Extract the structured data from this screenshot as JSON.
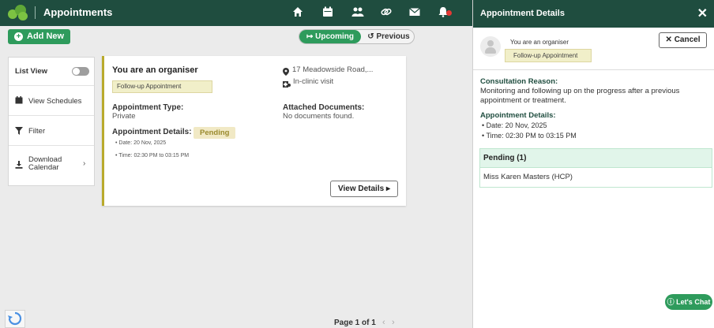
{
  "app": {
    "title": "Appointments"
  },
  "nav": {
    "icons": [
      "home-icon",
      "calendar-icon",
      "people-icon",
      "link-icon",
      "mail-icon",
      "bell-icon"
    ]
  },
  "toolbar": {
    "add_label": "Add New",
    "upcoming_label": "Upcoming",
    "previous_label": "Previous"
  },
  "sidebar": {
    "items": [
      {
        "label": "List View"
      },
      {
        "label": "View Schedules"
      },
      {
        "label": "Filter"
      },
      {
        "label": "Download Calendar"
      }
    ]
  },
  "card": {
    "title": "You are an organiser",
    "tag": "Follow-up Appointment",
    "location": "17 Meadowside Road,...",
    "visit_type": "In-clinic visit",
    "type_label": "Appointment Type:",
    "type_value": "Private",
    "docs_label": "Attached Documents:",
    "docs_value": "No documents found.",
    "details_label": "Appointment Details:",
    "status": "Pending",
    "date": "Date: 20 Nov, 2025",
    "time": "Time: 02:30 PM to 03:15 PM",
    "view_label": "View Details"
  },
  "pager": {
    "label": "Page 1 of 1",
    "prev": "‹",
    "next": "›"
  },
  "panel": {
    "title": "Appointment Details",
    "organiser": "You are an organiser",
    "tag": "Follow-up Appointment",
    "cancel_label": "Cancel",
    "reason_label": "Consultation Reason:",
    "reason_text": "Monitoring and following up on the progress after a previous appointment or treatment.",
    "details_label": "Appointment Details:",
    "date": "Date: 20 Nov, 2025",
    "time": "Time: 02:30 PM to 03:15 PM",
    "pending_header": "Pending (1)",
    "pending_person": "Miss Karen Masters (HCP)"
  },
  "chat": {
    "label": "Let's Chat"
  },
  "colors": {
    "brand": "#1f4d3f",
    "accent": "#2e9b5c",
    "pending": "#9a8a2e"
  }
}
